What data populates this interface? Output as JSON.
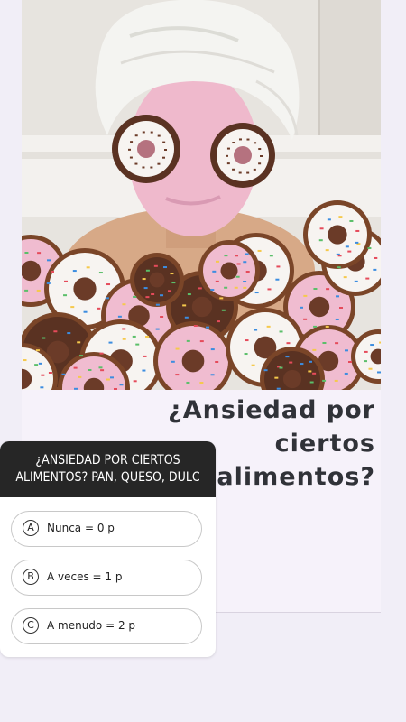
{
  "headline": {
    "line1": "¿Ansiedad por",
    "line2": "ciertos",
    "line3": "alimentos?"
  },
  "quiz": {
    "question_line1": "¿ANSIEDAD POR CIERTOS",
    "question_line2": "ALIMENTOS? PAN, QUESO, DULC",
    "options": [
      {
        "letter": "A",
        "label": "Nunca = 0 p"
      },
      {
        "letter": "B",
        "label": "A veces = 1 p"
      },
      {
        "letter": "C",
        "label": "A menudo = 2 p"
      }
    ]
  },
  "colors": {
    "background": "#f1eef7",
    "headline_text": "#303238",
    "quiz_header": "#262626",
    "donut_icing_pink": "#f0bcd0",
    "donut_icing_white": "#f7f4f1",
    "donut_chocolate": "#5a3222"
  }
}
